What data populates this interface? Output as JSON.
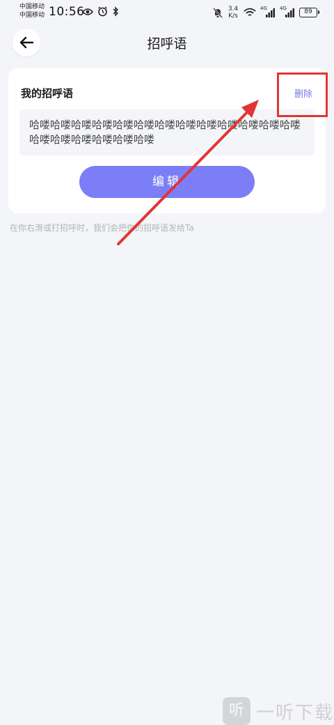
{
  "status_bar": {
    "carrier_1": "中国移动",
    "carrier_2": "中国移动",
    "time": "10:56",
    "net_speed_value": "3.4",
    "net_speed_unit": "K/s",
    "signal_1_tag": "4G",
    "signal_2_tag": "4G",
    "battery": "89",
    "icons": [
      "eye-icon",
      "alarm-icon",
      "bluetooth-icon",
      "mute-bell-icon",
      "wifi-icon",
      "signal-icon",
      "battery-icon"
    ]
  },
  "header": {
    "title": "招呼语"
  },
  "card": {
    "title": "我的招呼语",
    "delete_label": "删除",
    "greeting_text": "哈喽哈喽哈喽哈喽哈喽哈喽哈喽哈喽哈喽哈喽哈喽哈喽哈喽哈喽哈喽哈喽哈喽哈喽哈喽",
    "edit_label": "编辑"
  },
  "hint": "在你右滑或打招呼时，我们会把你的招呼语发给Ta",
  "watermark": {
    "logo_glyph": "听",
    "text": "一听下载"
  },
  "colors": {
    "accent": "#7b7ef7",
    "delete_text": "#7779e8",
    "annotation_red": "#e23434",
    "background": "#f4f5f8"
  }
}
